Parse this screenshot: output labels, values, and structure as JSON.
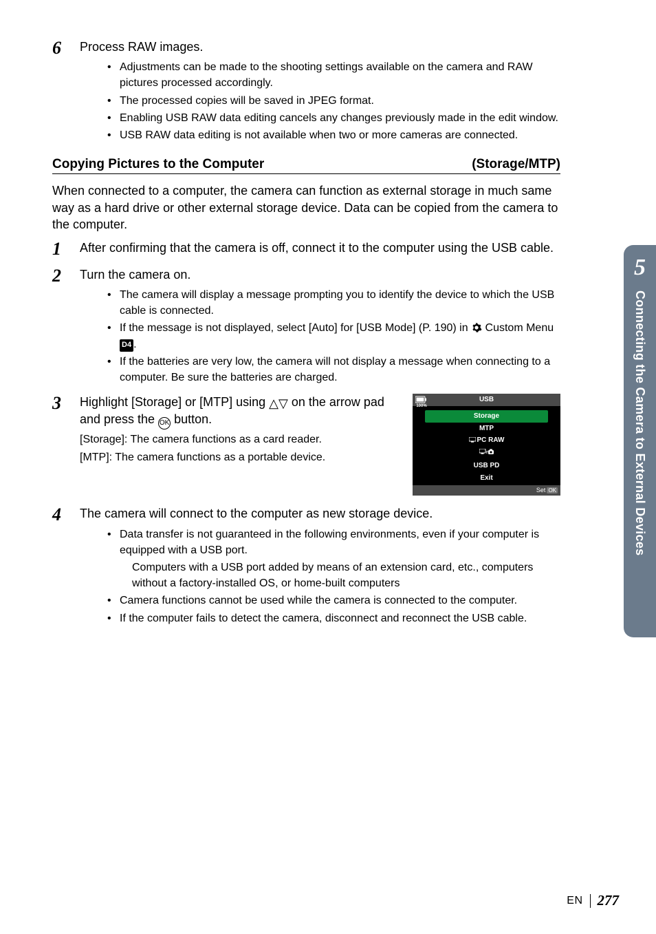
{
  "step6": {
    "num": "6",
    "title": "Process RAW images.",
    "bullets": [
      "Adjustments can be made to the shooting settings available on the camera and RAW pictures processed accordingly.",
      "The processed copies will be saved in JPEG format.",
      "Enabling USB RAW data editing cancels any changes previously made in the edit window.",
      "USB RAW data editing is not available when two or more cameras are connected."
    ]
  },
  "sectionHeading": {
    "left": "Copying Pictures to the Computer",
    "right": "(Storage/MTP)"
  },
  "introPara": "When connected to a computer, the camera can function as external storage in much same way as a hard drive or other external storage device. Data can be copied from the camera to the computer.",
  "step1": {
    "num": "1",
    "title": "After confirming that the camera is off, connect it to the computer using the USB cable."
  },
  "step2": {
    "num": "2",
    "title": "Turn the camera on.",
    "bullets": [
      "The camera will display a message prompting you to identify the device to which the USB cable is connected.",
      "__USB_MODE_BULLET__",
      "If the batteries are very low, the camera will not display a message when connecting to a computer. Be sure the batteries are charged."
    ],
    "usbModeParts": {
      "pre": "If the message is not displayed, select [Auto] for [USB Mode] (P. 190) in ",
      "mid": " Custom Menu ",
      "post": "."
    }
  },
  "step3": {
    "num": "3",
    "titleParts": {
      "a": "Highlight [Storage] or [MTP] using ",
      "b": " on the arrow pad and press the ",
      "c": " button."
    },
    "desc1": "[Storage]: The camera functions as a card reader.",
    "desc2": "[MTP]: The camera functions as a portable device."
  },
  "cameraScreen": {
    "title": "USB",
    "battery": "100%",
    "items": [
      "Storage",
      "MTP",
      "PC RAW",
      "__TETHER_ICON__",
      "USB PD",
      "Exit"
    ],
    "pcRawPrefix": "0",
    "bottom": "Set",
    "okLabel": "OK"
  },
  "step4": {
    "num": "4",
    "title": "The camera will connect to the computer as new storage device.",
    "bullet1": "Data transfer is not guaranteed in the following environments, even if your computer is equipped with a USB port.",
    "sub": "Computers with a USB port added by means of an extension card, etc., computers without a factory-installed OS, or home-built computers",
    "bullet2": "Camera functions cannot be used while the camera is connected to the computer.",
    "bullet3": "If the computer fails to detect the camera, disconnect and reconnect the USB cable."
  },
  "sideTab": {
    "num": "5",
    "title": "Connecting the Camera to External Devices"
  },
  "footer": {
    "lang": "EN",
    "page": "277"
  },
  "icons": {
    "d4": "D4",
    "ok": "OK"
  }
}
